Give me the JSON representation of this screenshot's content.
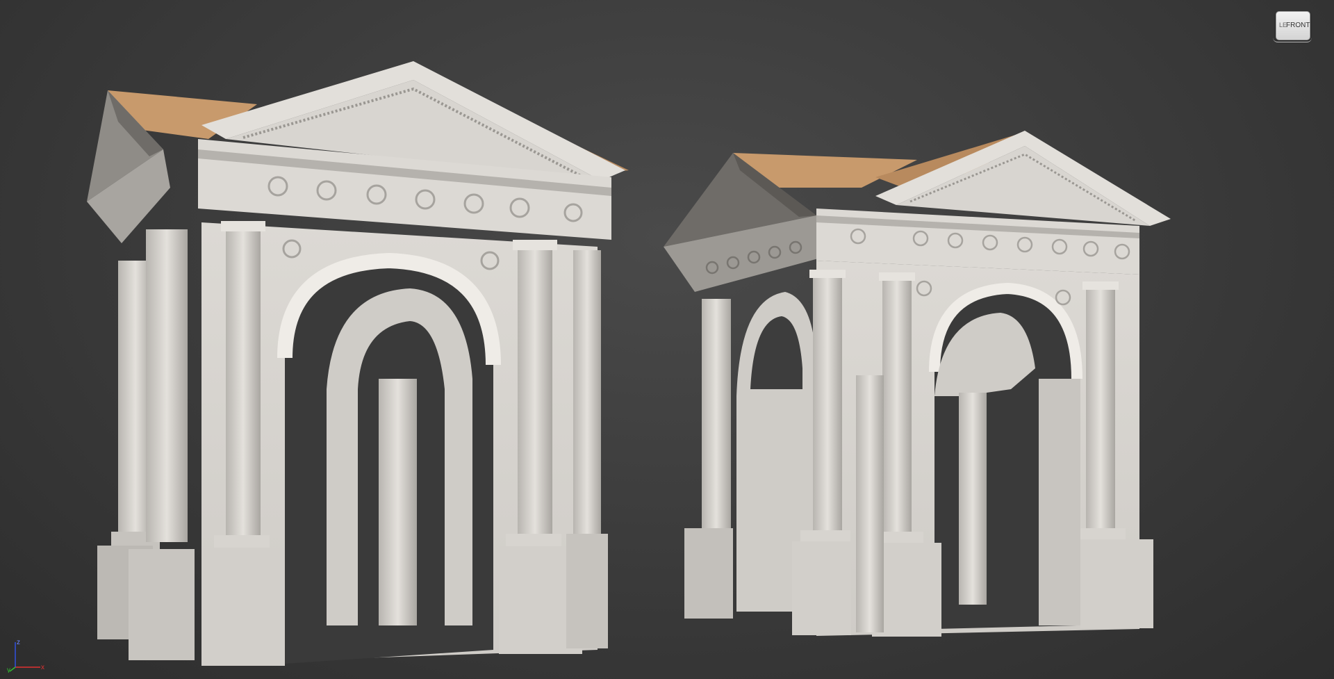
{
  "viewport": {
    "viewcube": {
      "face_label": "FRONT",
      "side_label": "LE"
    },
    "axis_tripod": {
      "x_label": "x",
      "y_label": "y",
      "z_label": "z"
    }
  },
  "colors": {
    "background": "#3a3a3a",
    "stone": "#d9d6d1",
    "stone_shadow": "#8a8782",
    "roof": "#c89a6c",
    "axis_x": "#e03030",
    "axis_y": "#30c030",
    "axis_z": "#3050e0"
  },
  "scene": {
    "objects": [
      {
        "name": "arch-gate-left",
        "roof_color": "#c89a6c"
      },
      {
        "name": "arch-gate-right",
        "roof_color": "#c89a6c"
      }
    ]
  }
}
